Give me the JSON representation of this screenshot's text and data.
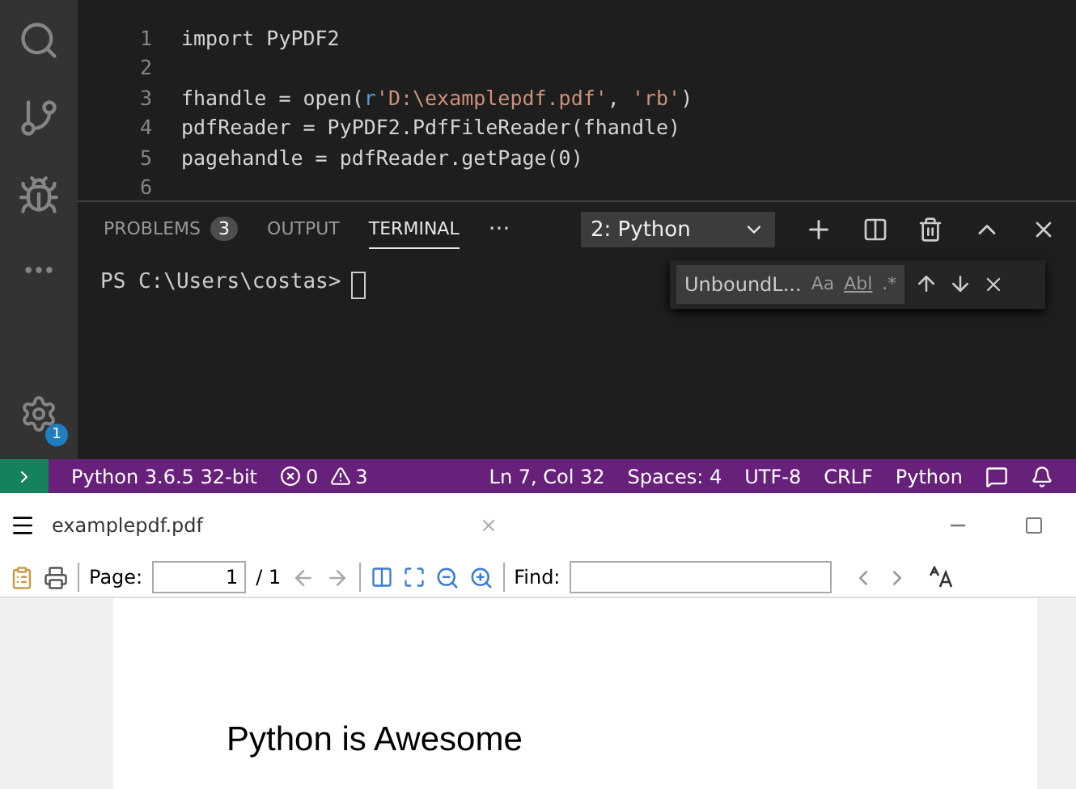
{
  "activity_bar": {
    "settings_badge": "1"
  },
  "editor": {
    "lines": [
      {
        "number": "1",
        "tokens": [
          {
            "text": "import PyPDF2",
            "kind": "plain"
          }
        ]
      },
      {
        "number": "2"
      },
      {
        "number": "3",
        "tokens": [
          {
            "text": "fhandle = open(",
            "kind": "plain"
          },
          {
            "text": "r",
            "kind": "keyword"
          },
          {
            "text": "'D:\\examplepdf.pdf'",
            "kind": "string"
          },
          {
            "text": ", ",
            "kind": "plain"
          },
          {
            "text": "'rb'",
            "kind": "string"
          },
          {
            "text": ")",
            "kind": "plain"
          }
        ]
      },
      {
        "number": "4",
        "tokens": [
          {
            "text": "pdfReader = PyPDF2.PdfFileReader(fhandle)",
            "kind": "plain"
          }
        ]
      },
      {
        "number": "5",
        "tokens": [
          {
            "text": "pagehandle = pdfReader.getPage(0)",
            "kind": "plain"
          }
        ]
      },
      {
        "number": "6"
      }
    ]
  },
  "panel": {
    "tabs": [
      {
        "label": "PROBLEMS",
        "badge": "3",
        "selected": false
      },
      {
        "label": "OUTPUT",
        "selected": false
      },
      {
        "label": "TERMINAL",
        "selected": true
      }
    ],
    "more": "···",
    "terminal_select": "2: Python",
    "prompt": "PS C:\\Users\\costas>",
    "find": {
      "value": "UnboundL...",
      "match_case": "Aa",
      "whole_word": "Abl",
      "regex": ".*"
    }
  },
  "status_bar": {
    "interpreter": "Python 3.6.5 32-bit",
    "errors": "0",
    "warnings": "3",
    "position": "Ln 7, Col 32",
    "indent": "Spaces: 4",
    "encoding": "UTF-8",
    "eol": "CRLF",
    "language": "Python"
  },
  "pdf_viewer": {
    "title": "examplepdf.pdf",
    "page_label": "Page:",
    "page_value": "1",
    "page_total": "/ 1",
    "find_label": "Find:",
    "page_text": "Python is Awesome"
  }
}
